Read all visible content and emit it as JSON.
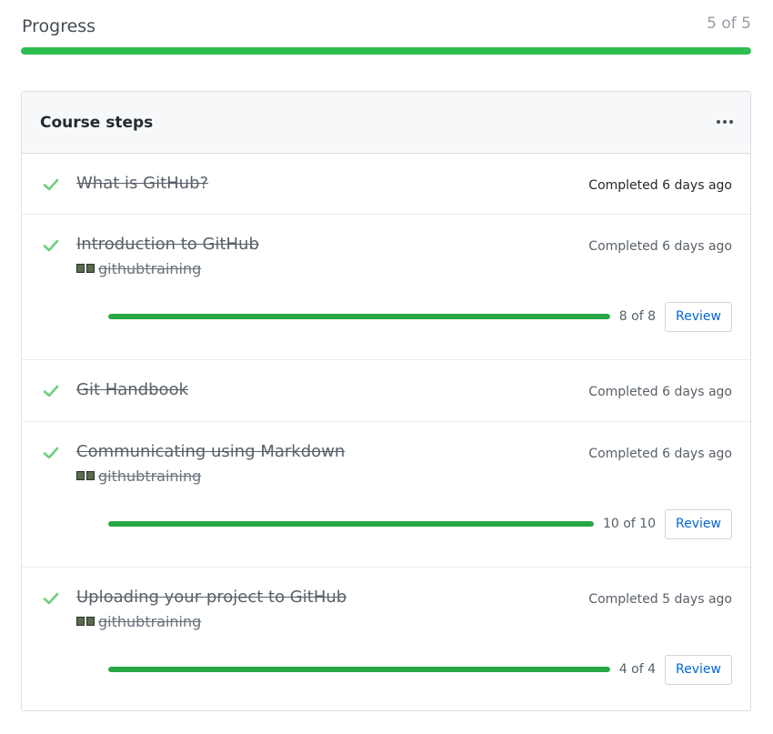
{
  "colors": {
    "accent_green": "#2cbe4e",
    "bar_green": "#28a745",
    "check_green": "#6fcf7e",
    "link_blue": "#0366d6"
  },
  "progress": {
    "title": "Progress",
    "count_label": "5 of 5",
    "completed": 5,
    "total": 5
  },
  "course": {
    "title": "Course steps",
    "more_icon": "kebab-horizontal-icon",
    "steps": [
      {
        "title": "What is GitHub?",
        "status": "Completed 6 days ago",
        "has_detail": false
      },
      {
        "title": "Introduction to GitHub",
        "status": "Completed 6 days ago",
        "has_detail": true,
        "owner": "githubtraining",
        "done": 8,
        "total": 8,
        "count_label": "8 of 8",
        "review_label": "Review"
      },
      {
        "title": "Git Handbook",
        "status": "Completed 6 days ago",
        "has_detail": false
      },
      {
        "title": "Communicating using Markdown",
        "status": "Completed 6 days ago",
        "has_detail": true,
        "owner": "githubtraining",
        "done": 10,
        "total": 10,
        "count_label": "10 of 10",
        "review_label": "Review"
      },
      {
        "title": "Uploading your project to GitHub",
        "status": "Completed 5 days ago",
        "has_detail": true,
        "owner": "githubtraining",
        "done": 4,
        "total": 4,
        "count_label": "4 of 4",
        "review_label": "Review"
      }
    ]
  }
}
